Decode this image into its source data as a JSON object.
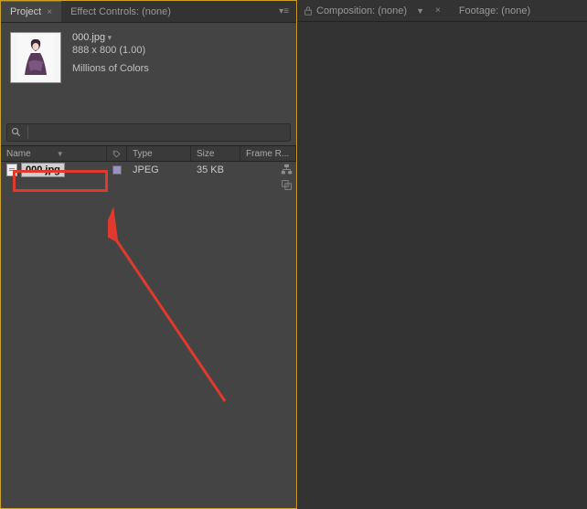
{
  "leftTabs": {
    "project": "Project",
    "effectControls": "Effect Controls: (none)"
  },
  "rightTabs": {
    "composition": "Composition: (none)",
    "footage": "Footage: (none)"
  },
  "asset": {
    "name": "000.jpg",
    "dimensions": "888 x 800 (1.00)",
    "colorDepth": "Millions of Colors"
  },
  "columns": {
    "name": "Name",
    "type": "Type",
    "size": "Size",
    "frameRate": "Frame R..."
  },
  "rows": [
    {
      "name": "000.jpg",
      "type": "JPEG",
      "size": "35 KB",
      "frameRate": ""
    }
  ]
}
